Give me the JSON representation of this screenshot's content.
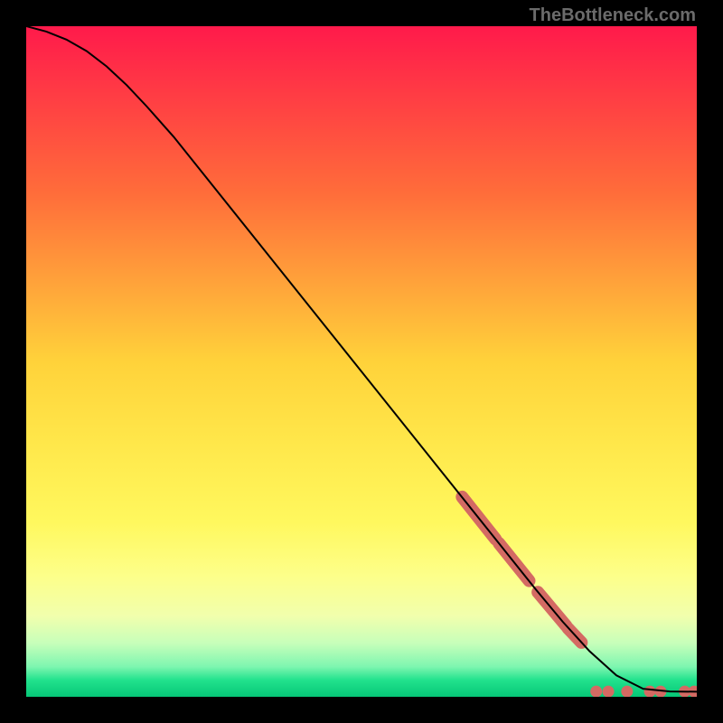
{
  "attribution": "TheBottleneck.com",
  "chart_data": {
    "type": "line",
    "title": "",
    "xlabel": "",
    "ylabel": "",
    "xlim": [
      0,
      100
    ],
    "ylim": [
      0,
      100
    ],
    "background_gradient": {
      "stops": [
        {
          "offset": 0,
          "color": "#ff1a4b"
        },
        {
          "offset": 0.25,
          "color": "#ff6d3a"
        },
        {
          "offset": 0.5,
          "color": "#ffd23a"
        },
        {
          "offset": 0.62,
          "color": "#ffe74a"
        },
        {
          "offset": 0.74,
          "color": "#fff85e"
        },
        {
          "offset": 0.82,
          "color": "#fdff8a"
        },
        {
          "offset": 0.88,
          "color": "#f1ffad"
        },
        {
          "offset": 0.92,
          "color": "#c7ffba"
        },
        {
          "offset": 0.955,
          "color": "#7ef6b0"
        },
        {
          "offset": 0.975,
          "color": "#22e28d"
        },
        {
          "offset": 1.0,
          "color": "#06c777"
        }
      ]
    },
    "series": [
      {
        "name": "curve",
        "stroke": "#000000",
        "x": [
          0,
          3,
          6,
          9,
          12,
          15,
          18,
          22,
          30,
          40,
          50,
          60,
          70,
          76,
          80,
          84,
          88,
          92,
          96,
          100
        ],
        "y": [
          100,
          99.2,
          98,
          96.3,
          94,
          91.2,
          88,
          83.5,
          73.5,
          61,
          48.5,
          36,
          23.5,
          16,
          11.2,
          6.8,
          3.2,
          1.2,
          0.8,
          0.75
        ]
      }
    ],
    "blobs": {
      "color": "#d46a63",
      "runs": [
        {
          "x0": 65.0,
          "x1": 70.0,
          "y0": 29.8,
          "y1": 23.5,
          "r": 7
        },
        {
          "x0": 70.5,
          "x1": 75.0,
          "y0": 22.9,
          "y1": 17.3,
          "r": 7
        },
        {
          "x0": 76.3,
          "x1": 80.5,
          "y0": 15.6,
          "y1": 10.6,
          "r": 7
        },
        {
          "x0": 80.8,
          "x1": 82.8,
          "y0": 10.2,
          "y1": 8.1,
          "r": 7
        }
      ],
      "dots": [
        {
          "x": 85.0,
          "y": 0.8,
          "r": 6.5
        },
        {
          "x": 86.8,
          "y": 0.8,
          "r": 6.5
        },
        {
          "x": 89.6,
          "y": 0.8,
          "r": 6.5
        },
        {
          "x": 93.0,
          "y": 0.8,
          "r": 6.5
        },
        {
          "x": 94.6,
          "y": 0.8,
          "r": 6.5
        },
        {
          "x": 98.2,
          "y": 0.8,
          "r": 6.5
        },
        {
          "x": 99.6,
          "y": 0.8,
          "r": 6.5
        }
      ]
    }
  }
}
